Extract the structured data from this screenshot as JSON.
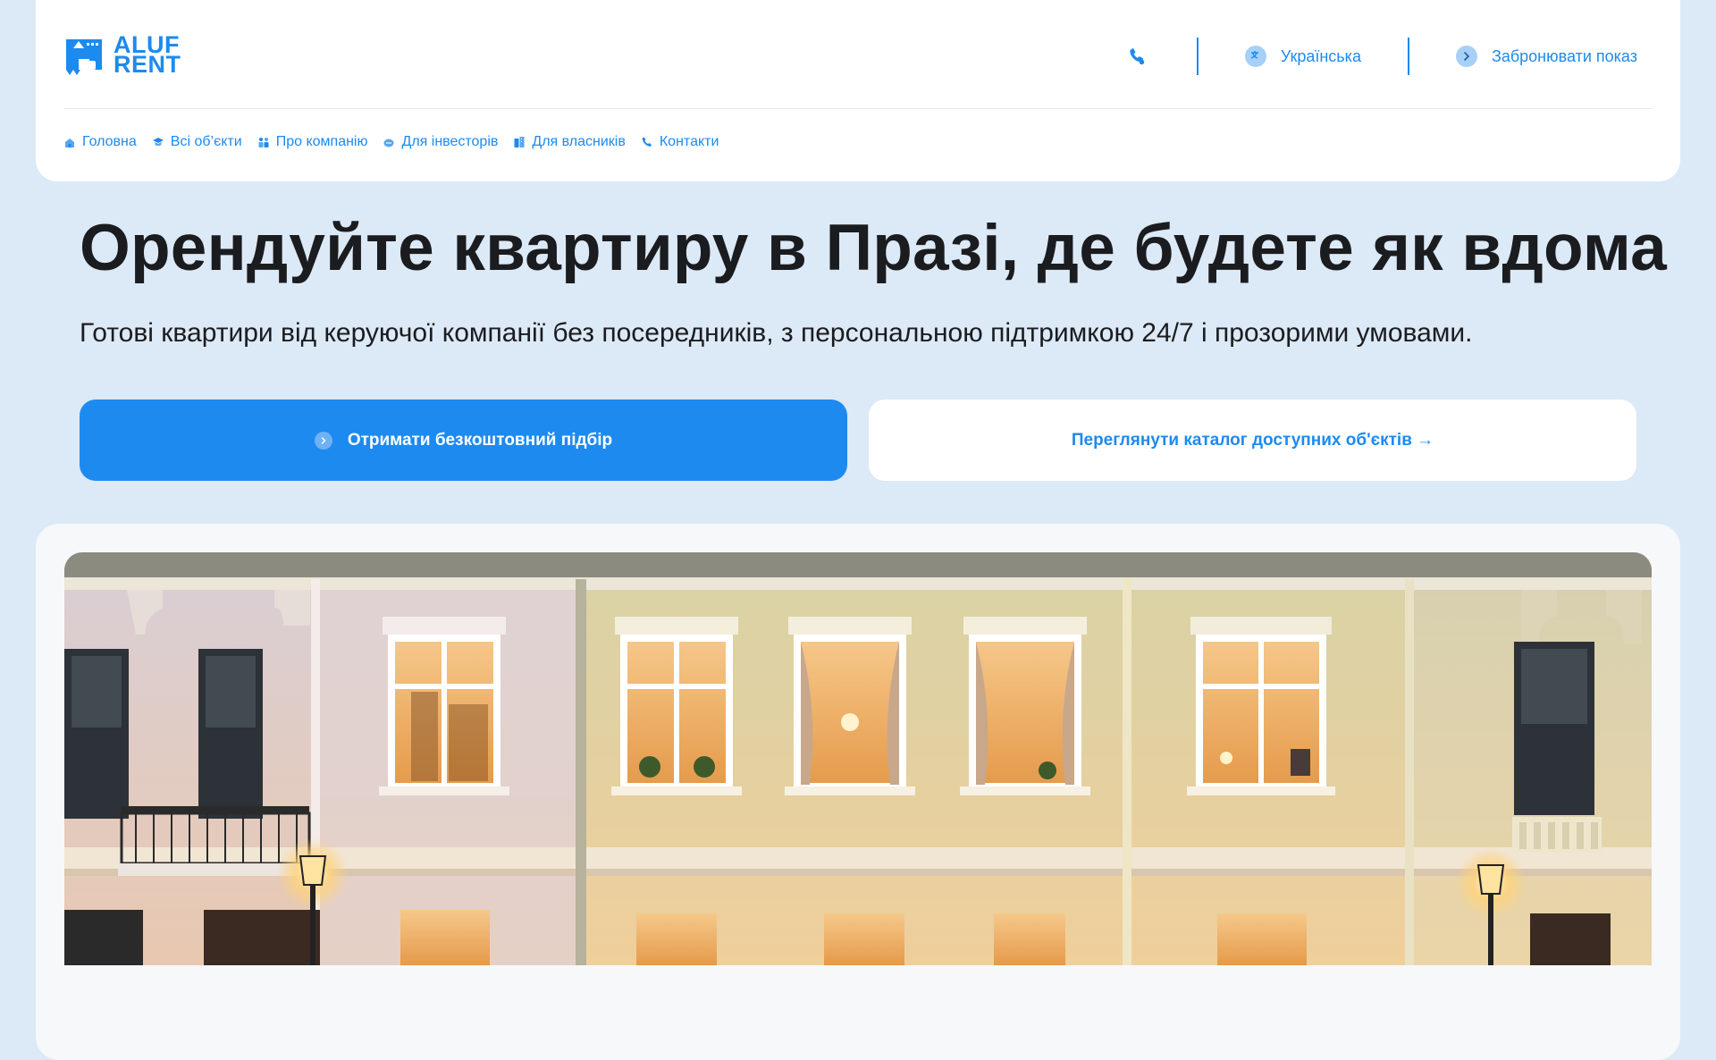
{
  "brand": {
    "logo_line1": "ALUF",
    "logo_line2": "RENT",
    "accent": "#1d8af0",
    "background": "#dce9f6"
  },
  "header": {
    "phone_icon": "phone-icon",
    "language_label": "Українська",
    "language_icon": "translate-icon",
    "book_label": "Забронювати показ",
    "book_icon": "chevron-right-icon"
  },
  "nav": {
    "items": [
      {
        "label": "Головна",
        "icon": "home-icon"
      },
      {
        "label": "Всі об’єкти",
        "icon": "graduation-cap-icon"
      },
      {
        "label": "Про компанію",
        "icon": "team-icon"
      },
      {
        "label": "Для інвесторів",
        "icon": "investor-icon"
      },
      {
        "label": "Для власників",
        "icon": "building-icon"
      },
      {
        "label": "Контакти",
        "icon": "phone-icon"
      }
    ]
  },
  "hero": {
    "title": "Орендуйте квартиру в Празі, де будете як вдома",
    "subtitle": "Готові квартири від керуючої компанії без посередників, з персональною підтримкою 24/7 і прозорими умовами.",
    "primary_cta": "Отримати безкоштовний підбір",
    "secondary_cta": "Переглянути каталог доступних об'єктів →"
  },
  "image": {
    "subject": "building-facade-photo"
  }
}
